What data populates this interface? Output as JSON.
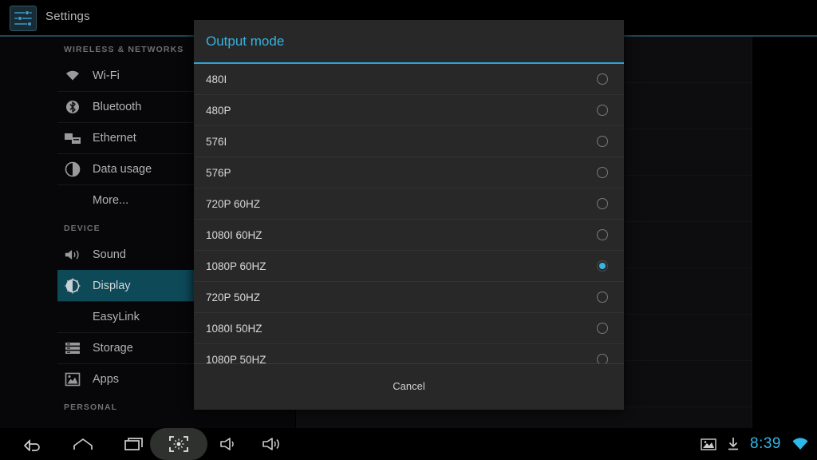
{
  "actionbar": {
    "title": "Settings",
    "app_icon": "settings-sliders-icon"
  },
  "sidebar": {
    "sections": [
      {
        "header": "WIRELESS & NETWORKS",
        "items": [
          {
            "label": "Wi-Fi",
            "icon": "wifi-icon",
            "selected": false,
            "sub": false
          },
          {
            "label": "Bluetooth",
            "icon": "bluetooth-icon",
            "selected": false,
            "sub": false
          },
          {
            "label": "Ethernet",
            "icon": "ethernet-icon",
            "selected": false,
            "sub": false
          },
          {
            "label": "Data usage",
            "icon": "data-usage-icon",
            "selected": false,
            "sub": false
          },
          {
            "label": "More...",
            "icon": "none",
            "selected": false,
            "sub": true
          }
        ]
      },
      {
        "header": "DEVICE",
        "items": [
          {
            "label": "Sound",
            "icon": "sound-icon",
            "selected": false,
            "sub": false
          },
          {
            "label": "Display",
            "icon": "display-icon",
            "selected": true,
            "sub": false
          },
          {
            "label": "EasyLink",
            "icon": "none",
            "selected": false,
            "sub": true
          },
          {
            "label": "Storage",
            "icon": "storage-icon",
            "selected": false,
            "sub": false
          },
          {
            "label": "Apps",
            "icon": "apps-icon",
            "selected": false,
            "sub": false
          }
        ]
      },
      {
        "header": "PERSONAL",
        "items": []
      }
    ]
  },
  "dialog": {
    "title": "Output mode",
    "accent_color": "#33b5e5",
    "cancel_label": "Cancel",
    "options": [
      {
        "label": "480I",
        "selected": false
      },
      {
        "label": "480P",
        "selected": false
      },
      {
        "label": "576I",
        "selected": false
      },
      {
        "label": "576P",
        "selected": false
      },
      {
        "label": "720P 60HZ",
        "selected": false
      },
      {
        "label": "1080I 60HZ",
        "selected": false
      },
      {
        "label": "1080P 60HZ",
        "selected": true
      },
      {
        "label": "720P 50HZ",
        "selected": false
      },
      {
        "label": "1080I 50HZ",
        "selected": false
      },
      {
        "label": "1080P 50HZ",
        "selected": false
      }
    ]
  },
  "navbar": {
    "buttons": [
      {
        "name": "back-icon",
        "highlighted": false
      },
      {
        "name": "home-icon",
        "highlighted": false
      },
      {
        "name": "recents-icon",
        "highlighted": false
      },
      {
        "name": "screenshot-icon",
        "highlighted": true
      },
      {
        "name": "volume-down-icon",
        "highlighted": false
      },
      {
        "name": "volume-up-icon",
        "highlighted": false
      }
    ],
    "status": {
      "image_icon": "image-icon",
      "download_icon": "download-icon",
      "clock": "8:39",
      "wifi_icon": "wifi-signal-icon",
      "clock_color": "#2fb8e8"
    }
  }
}
